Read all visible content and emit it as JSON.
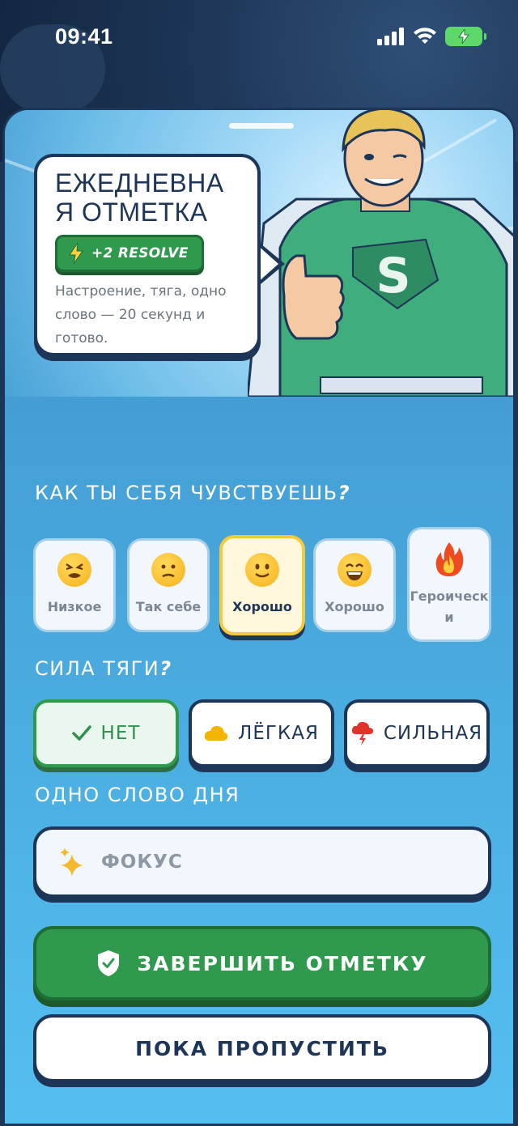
{
  "status_bar": {
    "time": "09:41"
  },
  "hero": {
    "title": "ЕЖЕДНЕВНАЯ ОТМЕТКА",
    "title_line1": "ЕЖЕДНЕВНА",
    "title_line2": "Я ОТМЕТКА",
    "badge": "+2 RESOLVE",
    "description": "Настроение, тяга, одно слово — 20 секунд и готово."
  },
  "mood_section": {
    "title": "КАК ТЫ СЕБЯ ЧУВСТВУЕШЬ",
    "title_mark": "?",
    "options": [
      {
        "label": "Низкое",
        "icon": "tired-face-icon",
        "selected": false
      },
      {
        "label": "Так себе",
        "icon": "confused-face-icon",
        "selected": false
      },
      {
        "label": "Хорошо",
        "icon": "slight-smile-icon",
        "selected": true
      },
      {
        "label": "Хорошо",
        "icon": "grin-face-icon",
        "selected": false
      },
      {
        "label": "Героическ\nи",
        "icon": "fire-icon",
        "selected": false
      }
    ]
  },
  "craving_section": {
    "title": "СИЛА ТЯГИ",
    "title_mark": "?",
    "options": [
      {
        "label": "НЕТ",
        "icon": "check-icon",
        "selected": true
      },
      {
        "label": "ЛЁГКАЯ",
        "icon": "cloud-icon",
        "selected": false
      },
      {
        "label": "СИЛЬНАЯ",
        "icon": "storm-cloud-icon",
        "selected": false
      }
    ]
  },
  "word_section": {
    "title": "ОДНО СЛОВО ДНЯ",
    "value": "ФОКУС"
  },
  "actions": {
    "primary": "ЗАВЕРШИТЬ ОТМЕТКУ",
    "secondary": "ПОКА ПРОПУСТИТЬ"
  },
  "colors": {
    "navy": "#1d3556",
    "green": "#2f9a4e",
    "selected_border": "#f5c93c",
    "sky": "#46a3d8"
  }
}
